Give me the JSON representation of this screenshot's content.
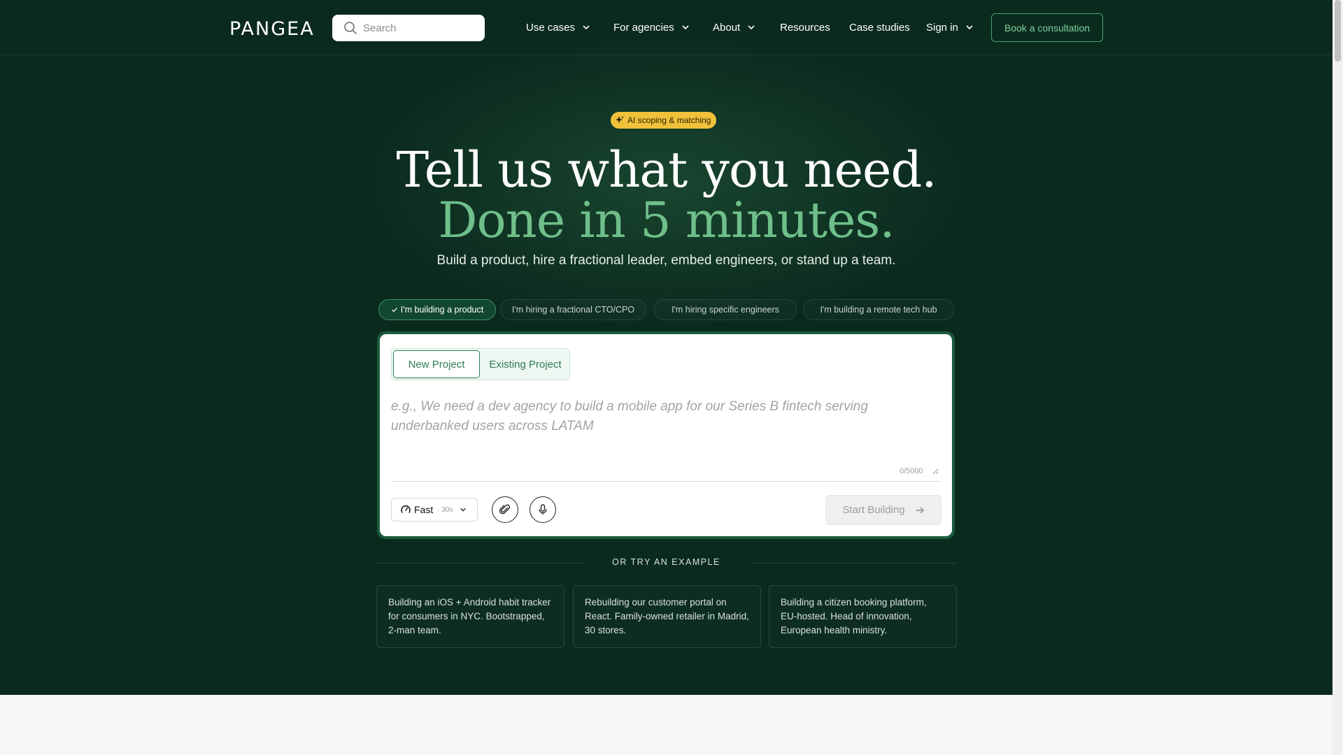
{
  "header": {
    "logo": "PANGEA",
    "search_placeholder": "Search",
    "nav": [
      {
        "label": "Use cases"
      },
      {
        "label": "For agencies"
      },
      {
        "label": "About"
      },
      {
        "label": "Resources"
      },
      {
        "label": "Case studies"
      },
      {
        "label": "Sign in"
      }
    ],
    "cta": "Book a consultation"
  },
  "hero": {
    "badge": "AI scoping & matching",
    "title_line1": "Tell us what you need.",
    "title_line2": "Done in 5 minutes.",
    "subtitle": "Build a product, hire a fractional leader, embed engineers, or stand up a team."
  },
  "pills": [
    {
      "label": "I'm building a product",
      "active": true
    },
    {
      "label": "I'm hiring a fractional CTO/CPO",
      "active": false
    },
    {
      "label": "I'm hiring specific engineers",
      "active": false
    },
    {
      "label": "I'm building a remote tech hub",
      "active": false
    }
  ],
  "composer": {
    "tabs": [
      "New Project",
      "Existing Project"
    ],
    "active_tab": "New Project",
    "placeholder": "e.g., We need a dev agency to build a mobile app for our Series B fintech serving underbanked users across LATAM",
    "value": "",
    "counter": "0/5000",
    "mode_label": "Fast",
    "mode_sub": "· 30s",
    "submit_label": "Start Building"
  },
  "examples": {
    "heading": "OR TRY AN EXAMPLE",
    "items": [
      "Building an iOS + Android habit tracker for consumers in NYC. Bootstrapped, 2-man team.",
      "Rebuilding our customer portal on React. Family-owned retailer in Madrid, 30 stores.",
      "Building a citizen booking platform, EU-hosted. Head of innovation, European health ministry."
    ]
  },
  "colors": {
    "background": "#0b2a1e",
    "accent_green": "#6fbf8a",
    "badge_yellow": "#f0c13a",
    "cta_border": "#4fa070"
  }
}
